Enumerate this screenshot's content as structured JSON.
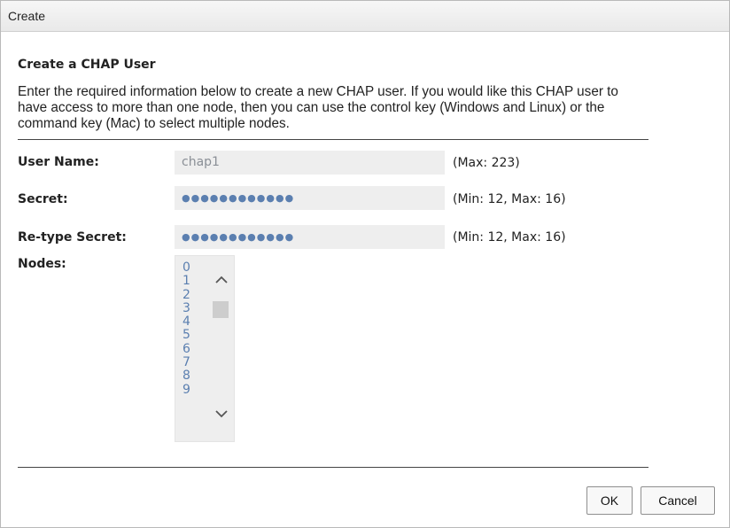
{
  "dialog": {
    "title": "Create"
  },
  "section": {
    "title": "Create a CHAP User",
    "description": "Enter the required information below to create a new CHAP user. If you would like this CHAP user to have access to more than one node, then you can use the control key (Windows and Linux) or the command key (Mac) to select multiple nodes."
  },
  "form": {
    "user_name": {
      "label": "User Name:",
      "value": "chap1",
      "hint": "(Max: 223)"
    },
    "secret": {
      "label": "Secret:",
      "value": "●●●●●●●●●●●●",
      "hint": "(Min: 12, Max: 16)"
    },
    "retype_secret": {
      "label": "Re-type Secret:",
      "value": "●●●●●●●●●●●●",
      "hint": "(Min: 12, Max: 16)"
    },
    "nodes": {
      "label": "Nodes:",
      "options": [
        "0",
        "1",
        "2",
        "3",
        "4",
        "5",
        "6",
        "7",
        "8",
        "9"
      ]
    }
  },
  "buttons": {
    "ok": "OK",
    "cancel": "Cancel"
  },
  "icons": {
    "scroll_up": "chevron-up-icon",
    "scroll_down": "chevron-down-icon"
  }
}
